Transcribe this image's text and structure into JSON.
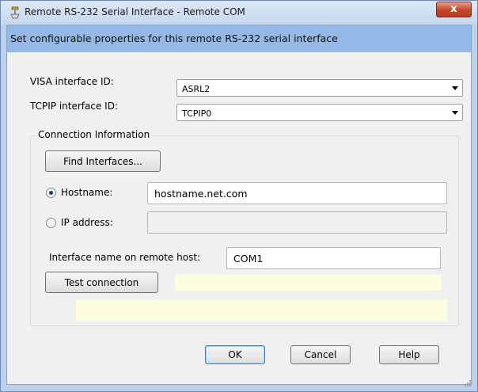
{
  "window": {
    "title": "Remote RS-232 Serial Interface - Remote COM",
    "close_label": "x"
  },
  "banner": {
    "text": "Set configurable properties for this  remote RS-232 serial interface"
  },
  "visa": {
    "label": "VISA interface ID:",
    "value": "ASRL2"
  },
  "tcpip": {
    "label": "TCPIP interface ID:",
    "value": "TCPIP0"
  },
  "connection": {
    "group_title": "Connection Information",
    "find_button": "Find Interfaces...",
    "hostname_label": "Hostname:",
    "hostname_value": "hostname.net.com",
    "hostname_selected": true,
    "ip_label": "IP address:",
    "ip_value": "",
    "remote_name_label": "Interface name on remote host:",
    "remote_name_value": "COM1",
    "test_button": "Test connection",
    "test_status": "",
    "test_details": ""
  },
  "buttons": {
    "ok": "OK",
    "cancel": "Cancel",
    "help": "Help"
  },
  "colors": {
    "banner": "#94b9e6",
    "status_field": "#fffde0",
    "close_button": "#c4452c"
  }
}
